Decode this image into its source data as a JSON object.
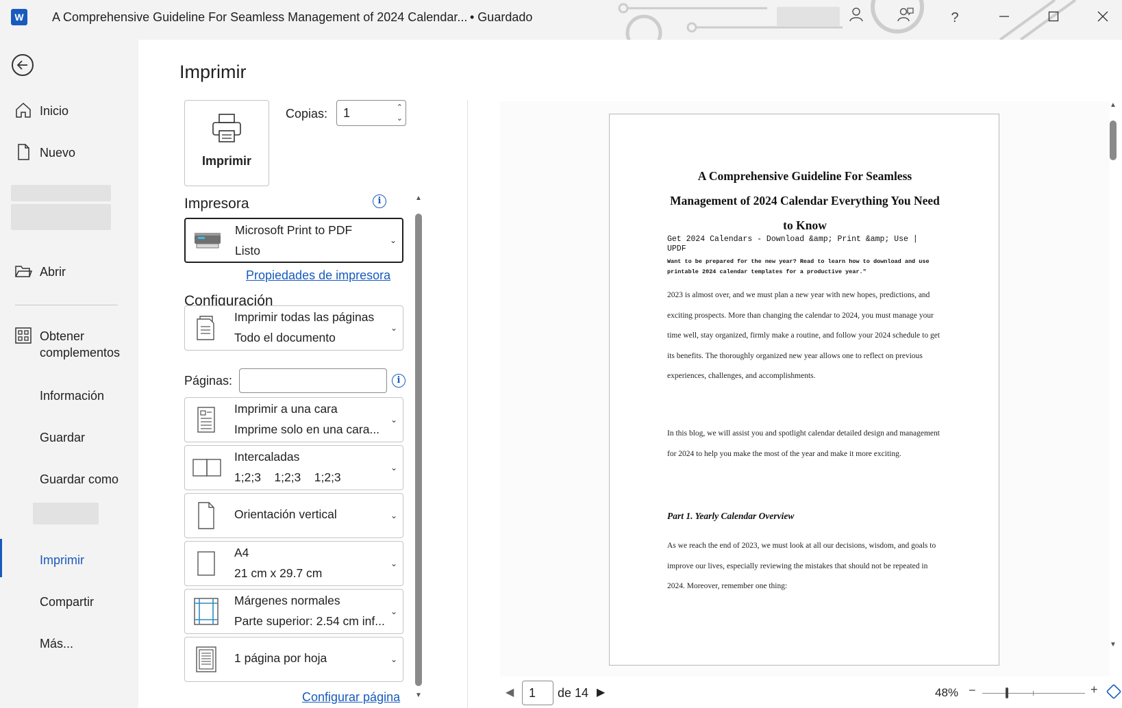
{
  "app": {
    "logo": "W",
    "doc_title": "A Comprehensive Guideline For Seamless Management of 2024 Calendar...",
    "status": "• Guardado",
    "help": "?"
  },
  "nav": {
    "items": [
      {
        "label": "Inicio",
        "icon": "home-icon"
      },
      {
        "label": "Nuevo",
        "icon": "new-document-icon"
      },
      {
        "label": "Abrir",
        "icon": "folder-open-icon"
      },
      {
        "label": "Obtener complementos",
        "icon": "addins-grid-icon"
      },
      {
        "label": "Información"
      },
      {
        "label": "Guardar"
      },
      {
        "label": "Guardar como"
      },
      {
        "label": "Imprimir",
        "active": true
      },
      {
        "label": "Compartir"
      },
      {
        "label": "Más..."
      }
    ]
  },
  "print": {
    "heading": "Imprimir",
    "button_label": "Imprimir",
    "copies_label": "Copias:",
    "copies_value": "1",
    "printer_section": "Impresora",
    "printer_name": "Microsoft Print to PDF",
    "printer_status": "Listo",
    "printer_properties": "Propiedades de impresora",
    "config_section": "Configuración",
    "pages_label": "Páginas:",
    "pages_placeholder": "",
    "settings": [
      {
        "line1": "Imprimir todas las páginas",
        "line2": "Todo el documento"
      },
      {
        "line1": "Imprimir a una cara",
        "line2": "Imprime solo en una cara..."
      },
      {
        "line1": "Intercaladas",
        "line2": "1;2;3    1;2;3    1;2;3"
      },
      {
        "line1": "Orientación vertical"
      },
      {
        "line1": "A4",
        "line2": "21 cm x 29.7 cm"
      },
      {
        "line1": "Márgenes normales",
        "line2": "Parte superior: 2.54 cm inf..."
      },
      {
        "line1": "1 página por hoja"
      }
    ],
    "page_setup": "Configurar página"
  },
  "preview": {
    "title": "A Comprehensive Guideline For Seamless Management of 2024 Calendar Everything You Need to Know",
    "meta_title": "Get 2024 Calendars - Download &amp; Print &amp; Use | UPDF",
    "meta_desc": "Want to be prepared for the new year? Read to learn how to download and use printable 2024 calendar templates for a productive year.\"",
    "para1": "2023 is almost over, and we must plan a new year with new hopes, predictions, and exciting prospects. More than changing the calendar to 2024, you must manage your time well, stay organized, firmly make a routine, and follow your 2024 schedule to get its benefits. The thoroughly organized new year allows one to reflect on previous experiences, challenges, and accomplishments.",
    "para2": "In this blog, we will assist you and spotlight calendar detailed design and management for 2024 to help you make the most of the year and make it more exciting.",
    "heading1": "Part 1. Yearly Calendar Overview",
    "para3": "As we reach the end of 2023, we must look at all our decisions, wisdom, and goals to improve our lives, especially reviewing the mistakes that should not be repeated in 2024. Moreover, remember one thing:"
  },
  "pager": {
    "current": "1",
    "of_label": "de 14",
    "zoom": "48%",
    "minus": "−",
    "plus": "+"
  }
}
